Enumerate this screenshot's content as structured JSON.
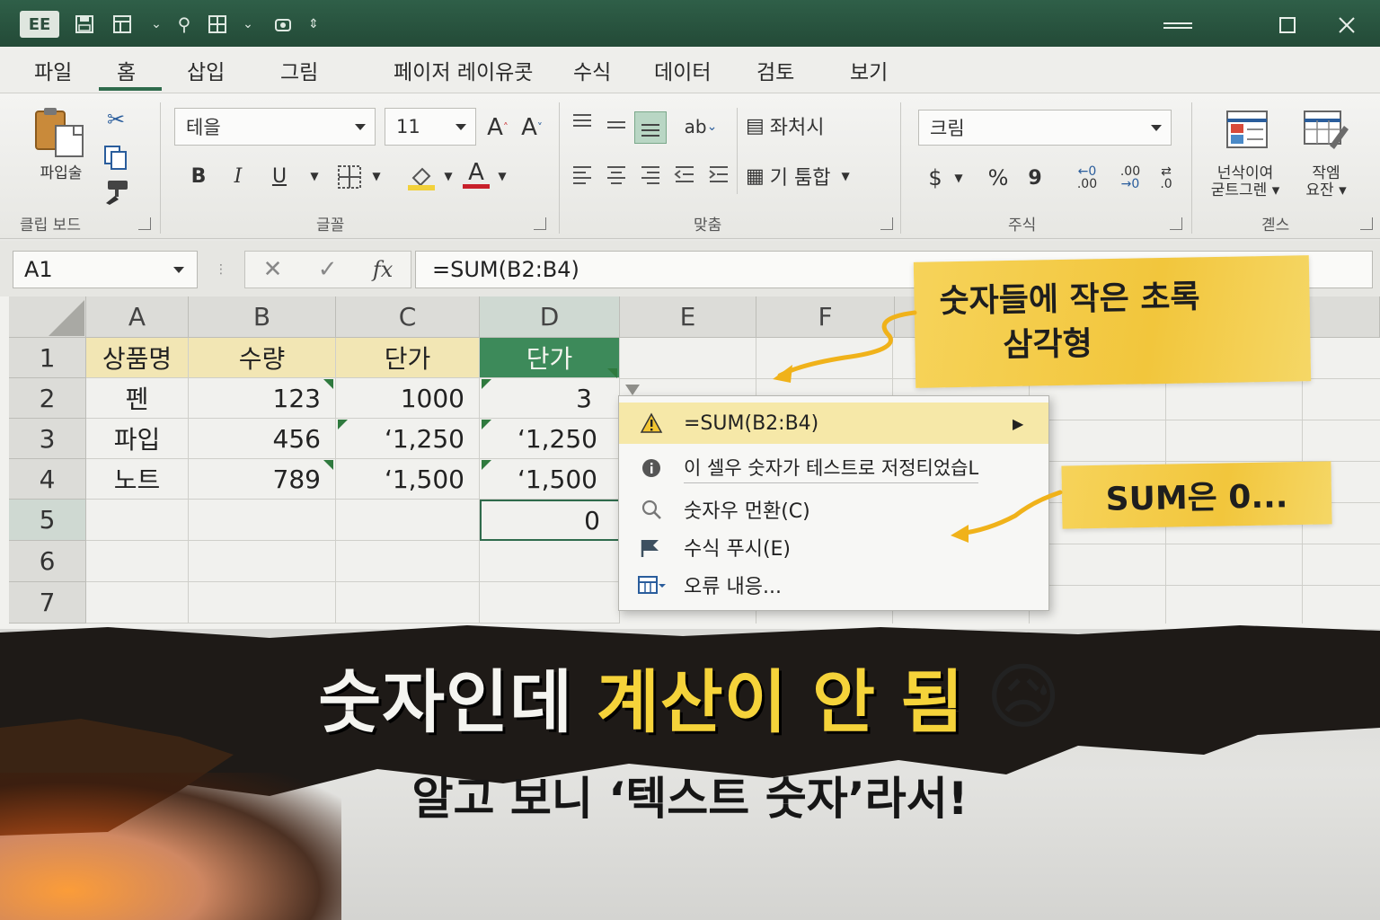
{
  "titlebar": {
    "app_badge": "EE",
    "qa_icons": [
      "save-icon",
      "form-icon",
      "dropdown-chevron-icon",
      "touch-icon",
      "table-icon",
      "dropdown-chevron-icon",
      "print-preview-icon",
      "customize-icon"
    ],
    "window_buttons": [
      "minimize-icon",
      "maximize-icon",
      "close-icon"
    ]
  },
  "menu": {
    "tabs": [
      {
        "label": "파일"
      },
      {
        "label": "홈"
      },
      {
        "label": "삽입"
      },
      {
        "label": "그림"
      },
      {
        "label": "페이저 레이유콧"
      },
      {
        "label": "수식"
      },
      {
        "label": "데이터"
      },
      {
        "label": "검토"
      },
      {
        "label": "보기"
      }
    ],
    "active_tab": "홈"
  },
  "ribbon": {
    "clipboard": {
      "paste_label": "파입술",
      "group_label": "클립 보드"
    },
    "font": {
      "font_name": "테을",
      "font_size": "11",
      "grow": "A",
      "shrink": "A",
      "bold": "B",
      "italic": "I",
      "underline": "U",
      "font_color_letter": "A",
      "group_label": "글꼴",
      "highlight_color": "#f2d13b",
      "font_color": "#c8202a"
    },
    "alignment": {
      "wrap_label": "좌처시",
      "merge_label": "기 툼합",
      "group_label": "맞춤"
    },
    "number": {
      "format": "크림",
      "currency": "$",
      "percent": "%",
      "comma": "9",
      "group_label": "주식"
    },
    "styles": {
      "cond_label_1": "넌삭이여",
      "cond_label_2": "굳트그렌",
      "format_label_1": "작엠",
      "format_label_2": "요잔",
      "group_label": "곋스"
    }
  },
  "formula_bar": {
    "name_box": "A1",
    "formula": "=SUM(B2:B4)",
    "fx": "fx",
    "cancel": "✕",
    "confirm": "✓"
  },
  "sheet": {
    "columns": [
      "A",
      "B",
      "C",
      "D",
      "E",
      "F"
    ],
    "rows": [
      "1",
      "2",
      "3",
      "4",
      "5",
      "6",
      "7"
    ],
    "header_row": [
      "상품명",
      "수량",
      "단가",
      "단가"
    ],
    "data": [
      [
        "펜",
        "123",
        "1000",
        "3"
      ],
      [
        "파입",
        "456",
        "‘1,250",
        "‘1,250"
      ],
      [
        "노트",
        "789",
        "‘1,500",
        "‘1,500"
      ]
    ],
    "sum_value": "0",
    "header_fill": "#f2e6b4",
    "selected_fill": "#3d8a5a",
    "error_triangle_color": "#2f7a3e"
  },
  "context_menu": {
    "items": [
      {
        "icon": "warning-icon",
        "label": "=SUM(B2:B4)"
      },
      {
        "icon": "info-icon",
        "label": "이 셀우 숫자가 테스트로 저정티었습L"
      },
      {
        "icon": "search-icon",
        "label": "숫자우 먼환(C)"
      },
      {
        "icon": "flag-icon",
        "label": "수식 푸시(E)"
      },
      {
        "icon": "grid-icon",
        "label": "오류 내응..."
      }
    ]
  },
  "annotations": {
    "note1_line1": "숫자들에 작은 초록",
    "note1_line2": "삼각형",
    "note2": "SUM은 0...",
    "arrow_color": "#f0b21a",
    "note_color": "#f2c63c"
  },
  "banner": {
    "headline_white": "숫자인데",
    "headline_yellow": "계산이 안 됨",
    "emoji": "😥",
    "subline": "알고 보니 ‘텍스트 숫자’라서!",
    "yellow": "#f5d33a"
  }
}
